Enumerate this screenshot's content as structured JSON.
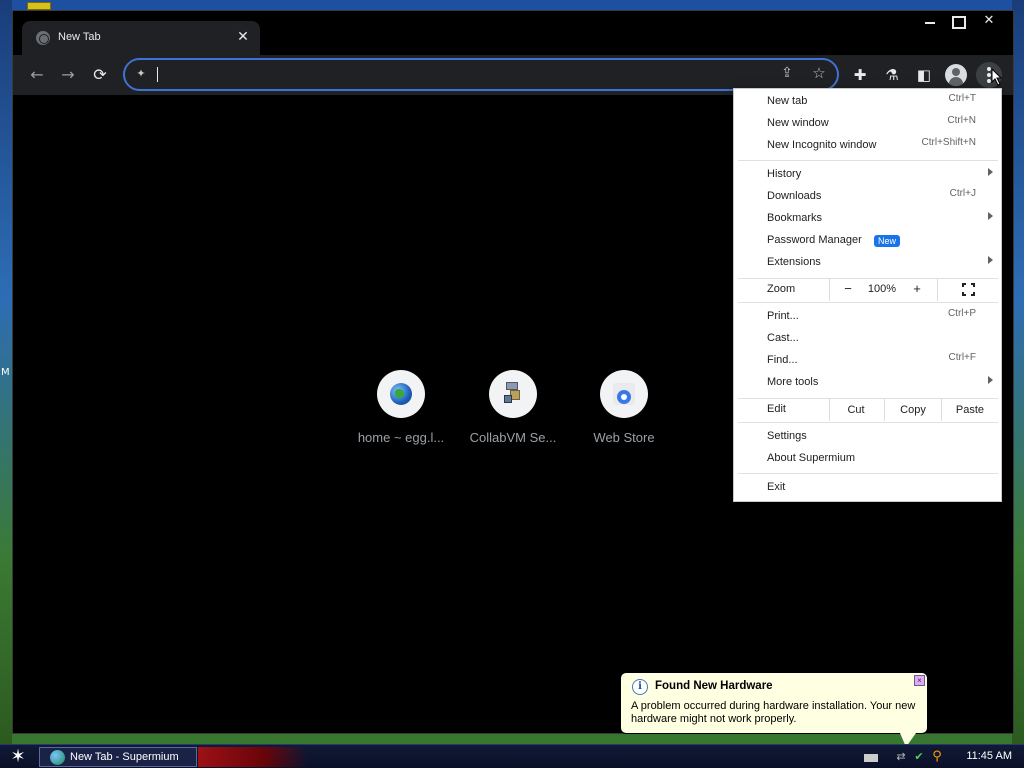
{
  "desktop": {
    "edge_text": "M"
  },
  "window": {
    "controls": {
      "minimize": "",
      "maximize": "",
      "close": "✕"
    }
  },
  "tab": {
    "title": "New Tab",
    "close_glyph": "✕"
  },
  "toolbar": {
    "back_glyph": "←",
    "forward_glyph": "→",
    "reload_glyph": "⟳",
    "address_value": "",
    "site_icon": "puzzle-site-icon",
    "share_glyph": "⇪",
    "bookmark_glyph": "☆",
    "extensions_glyph": "✚",
    "labs_glyph": "⚗",
    "sidepanel_glyph": "◧"
  },
  "shortcuts": [
    {
      "label": "home ~ egg.l...",
      "icon": "globe-icon"
    },
    {
      "label": "CollabVM Se...",
      "icon": "collabvm-icon"
    },
    {
      "label": "Web Store",
      "icon": "web-store-icon"
    }
  ],
  "menu": {
    "new_tab": {
      "label": "New tab",
      "shortcut": "Ctrl+T"
    },
    "new_window": {
      "label": "New window",
      "shortcut": "Ctrl+N"
    },
    "new_incognito": {
      "label": "New Incognito window",
      "shortcut": "Ctrl+Shift+N"
    },
    "history": {
      "label": "History"
    },
    "downloads": {
      "label": "Downloads",
      "shortcut": "Ctrl+J"
    },
    "bookmarks": {
      "label": "Bookmarks"
    },
    "password_manager": {
      "label": "Password Manager",
      "badge": "New"
    },
    "extensions": {
      "label": "Extensions"
    },
    "zoom": {
      "label": "Zoom",
      "minus": "−",
      "value": "100%",
      "plus": "+"
    },
    "print": {
      "label": "Print...",
      "shortcut": "Ctrl+P"
    },
    "cast": {
      "label": "Cast..."
    },
    "find": {
      "label": "Find...",
      "shortcut": "Ctrl+F"
    },
    "more_tools": {
      "label": "More tools"
    },
    "edit": {
      "label": "Edit",
      "cut": "Cut",
      "copy": "Copy",
      "paste": "Paste"
    },
    "settings": {
      "label": "Settings"
    },
    "about": {
      "label": "About Supermium"
    },
    "exit": {
      "label": "Exit"
    }
  },
  "taskbar": {
    "start_glyph": "✶",
    "task_label": "New Tab - Supermium",
    "clock": "11:45 AM"
  },
  "balloon": {
    "title": "Found New Hardware",
    "message": "A problem occurred during hardware installation. Your new hardware might not work properly.",
    "info_glyph": "i",
    "close_glyph": "×"
  }
}
